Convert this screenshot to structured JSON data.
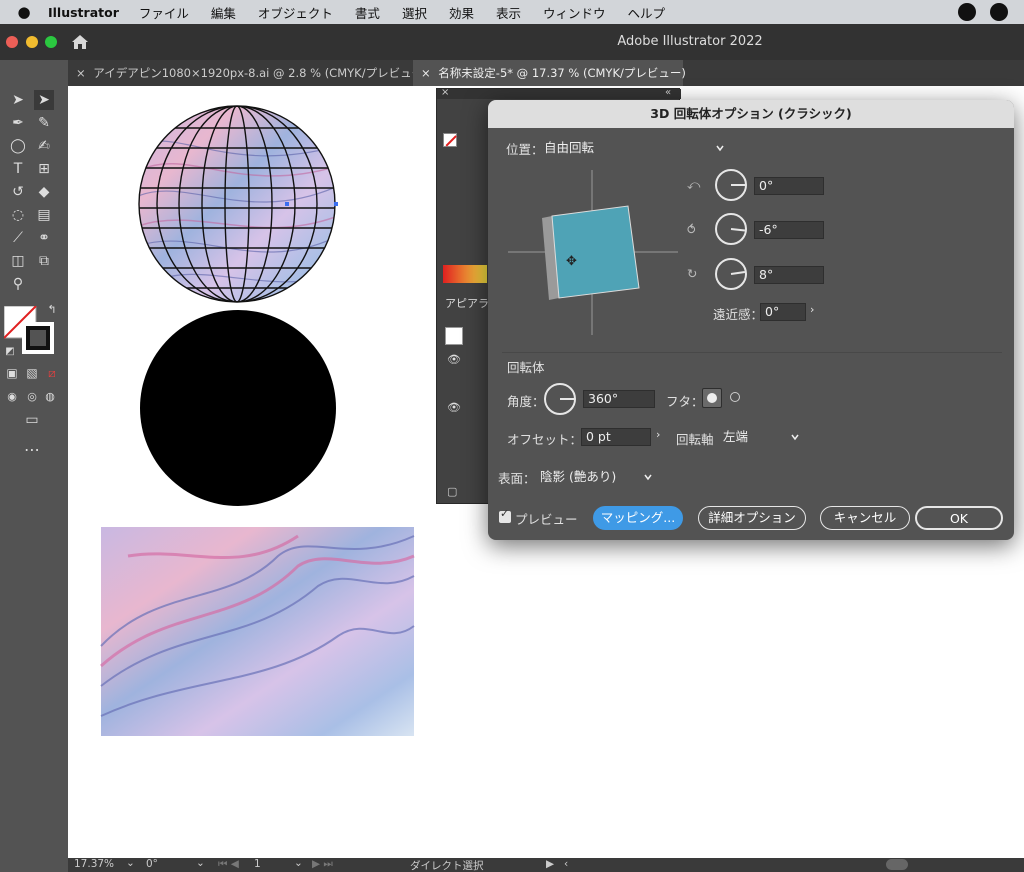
{
  "menubar": {
    "app": "Illustrator",
    "items": [
      "ファイル",
      "編集",
      "オブジェクト",
      "書式",
      "選択",
      "効果",
      "表示",
      "ウィンドウ",
      "ヘルプ"
    ]
  },
  "window": {
    "title": "Adobe Illustrator 2022"
  },
  "tabs": [
    {
      "label": "アイデアピン1080×1920px-8.ai @ 2.8 % (CMYK/プレビュー)"
    },
    {
      "label": "名称未設定-5* @ 17.37 % (CMYK/プレビュー)"
    }
  ],
  "panel": {
    "label": "アピアラ"
  },
  "dialog": {
    "title": "3D 回転体オプション (クラシック)",
    "position": {
      "label": "位置：",
      "value": "自由回転"
    },
    "rotation": {
      "x": "0°",
      "y": "-6°",
      "z": "8°"
    },
    "perspective": {
      "label": "遠近感：",
      "value": "0°"
    },
    "revolve": {
      "heading": "回転体",
      "angle_label": "角度：",
      "angle_value": "360°",
      "cap_label": "フタ：",
      "offset_label": "オフセット：",
      "offset_value": "0 pt",
      "axis_label": "回転軸",
      "axis_value": "左端"
    },
    "surface": {
      "label": "表面：",
      "value": "陰影 (艶あり)"
    },
    "preview_label": "プレビュー",
    "buttons": {
      "mapping": "マッピング...",
      "more": "詳細オプション",
      "cancel": "キャンセル",
      "ok": "OK"
    },
    "colors": {
      "cube_face": "#4fa3b6",
      "cube_side": "#9a9a9a",
      "primary": "#3f9ae6"
    }
  },
  "status": {
    "zoom": "17.37%",
    "rotation": "0°",
    "artboard": "1",
    "tool": "ダイレクト選択"
  }
}
